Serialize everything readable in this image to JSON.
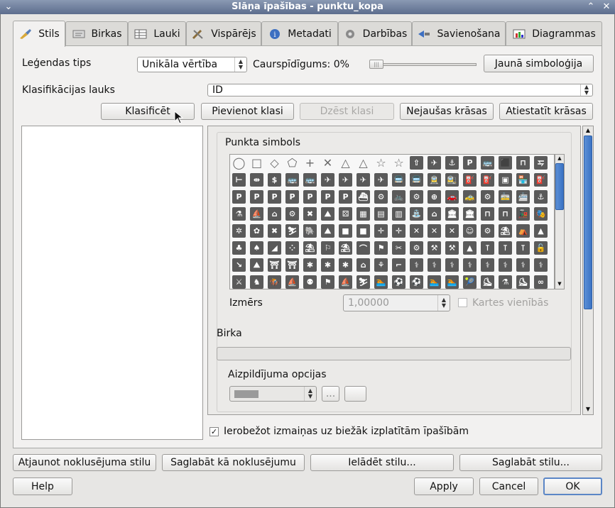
{
  "window": {
    "title": "Slāņa īpašības - punktu_kopa"
  },
  "tabs": [
    {
      "label": "Stils",
      "icon": "brush-icon"
    },
    {
      "label": "Birkas",
      "icon": "label-icon"
    },
    {
      "label": "Lauki",
      "icon": "table-icon"
    },
    {
      "label": "Vispārējs",
      "icon": "tools-icon"
    },
    {
      "label": "Metadati",
      "icon": "info-icon"
    },
    {
      "label": "Darbības",
      "icon": "gear-icon"
    },
    {
      "label": "Savienošana",
      "icon": "join-icon"
    },
    {
      "label": "Diagrammas",
      "icon": "chart-icon"
    }
  ],
  "style": {
    "legend_type_label": "Leģendas tips",
    "legend_type_value": "Unikāla vērtība",
    "transparency_label": "Caurspīdīgums: 0%",
    "new_symbology_button": "Jaunā simboloģija",
    "class_field_label": "Klasifikācijas lauks",
    "class_field_value": "ID",
    "classify_button": "Klasificēt",
    "add_class_button": "Pievienot klasi",
    "delete_class_button": "Dzēst klasi",
    "random_colors_button": "Nejaušas krāsas",
    "reset_colors_button": "Atiestatīt krāsas",
    "point_symbol_label": "Punkta simbols",
    "size_label": "Izmērs",
    "size_value": "1,00000",
    "map_units_label": "Kartes vienībās",
    "label_section": "Birka",
    "fill_options_label": "Aizpildījuma opcijas",
    "fill_more_button": "...",
    "restrict_label": "Ierobežot izmaiņas uz biežāk izplatītām īpašībām",
    "restrict_checked": true
  },
  "symbol_grid": [
    [
      "◯",
      "□",
      "◇",
      "⬠",
      "+",
      "✕",
      "△",
      "△",
      "☆",
      "☆",
      "⇧",
      "✈",
      "⚓",
      "P",
      "🚌",
      "⬛",
      "⊓",
      "⥧"
    ],
    [
      "⊢",
      "⇹",
      "$",
      "🚌",
      "🚌",
      "✈",
      "✈",
      "✈",
      "✈",
      "🚍",
      "🚍",
      "🚊",
      "🚉",
      "⛽",
      "⛽",
      "▣",
      "🏪",
      "⛽"
    ],
    [
      "P",
      "P",
      "P",
      "P",
      "P",
      "P",
      "P",
      "⛴",
      "⚙",
      "🚲",
      "⚙",
      "⊕",
      "🚗",
      "🚕",
      "⚙",
      "🚋",
      "🚈",
      "⚓"
    ],
    [
      "⚗",
      "⛵",
      "⌂",
      "⚙",
      "✖",
      "⛰",
      "⚄",
      "▦",
      "▤",
      "▥",
      "⛲",
      "⌂",
      "🏛",
      "🏛",
      "⊓",
      "⊓",
      "🚂",
      "🎭"
    ],
    [
      "✲",
      "✿",
      "✖",
      "⛷",
      "🐘",
      "⛰",
      "■",
      "■",
      "✛",
      "✛",
      "✕",
      "✕",
      "✕",
      "☺",
      "⚙",
      "⛱",
      "⛺",
      "▲"
    ],
    [
      "♣",
      "♠",
      "◢",
      "⁘",
      "⛱",
      "⚐",
      "⛱",
      "⌒",
      "⚑",
      "✂",
      "⚙",
      "⚒",
      "⚒",
      "▲",
      "⊺",
      "⊺",
      "⊺",
      "🔓"
    ],
    [
      "↘",
      "⛰",
      "⛩",
      "⛩",
      "✱",
      "✱",
      "✱",
      "⌂",
      "⚘",
      "⌐",
      "⚕",
      "⚕",
      "⚕",
      "⚕",
      "⚕",
      "⚕",
      "⚕",
      "⚕"
    ],
    [
      "⚔",
      "♞",
      "🏇",
      "⛵",
      "⚉",
      "⚑",
      "⛵",
      "⛷",
      "🏊",
      "⚽",
      "⚽",
      "🏊",
      "🏊",
      "🎾",
      "⛸",
      "⚗",
      "⛸",
      "∞"
    ]
  ],
  "bottom": {
    "restore_default_button": "Atjaunot noklusējuma stilu",
    "save_as_default_button": "Saglabāt kā noklusējumu",
    "load_style_button": "Ielādēt stilu...",
    "save_style_button": "Saglabāt stilu...",
    "help_button": "Help",
    "apply_button": "Apply",
    "cancel_button": "Cancel",
    "ok_button": "OK"
  }
}
